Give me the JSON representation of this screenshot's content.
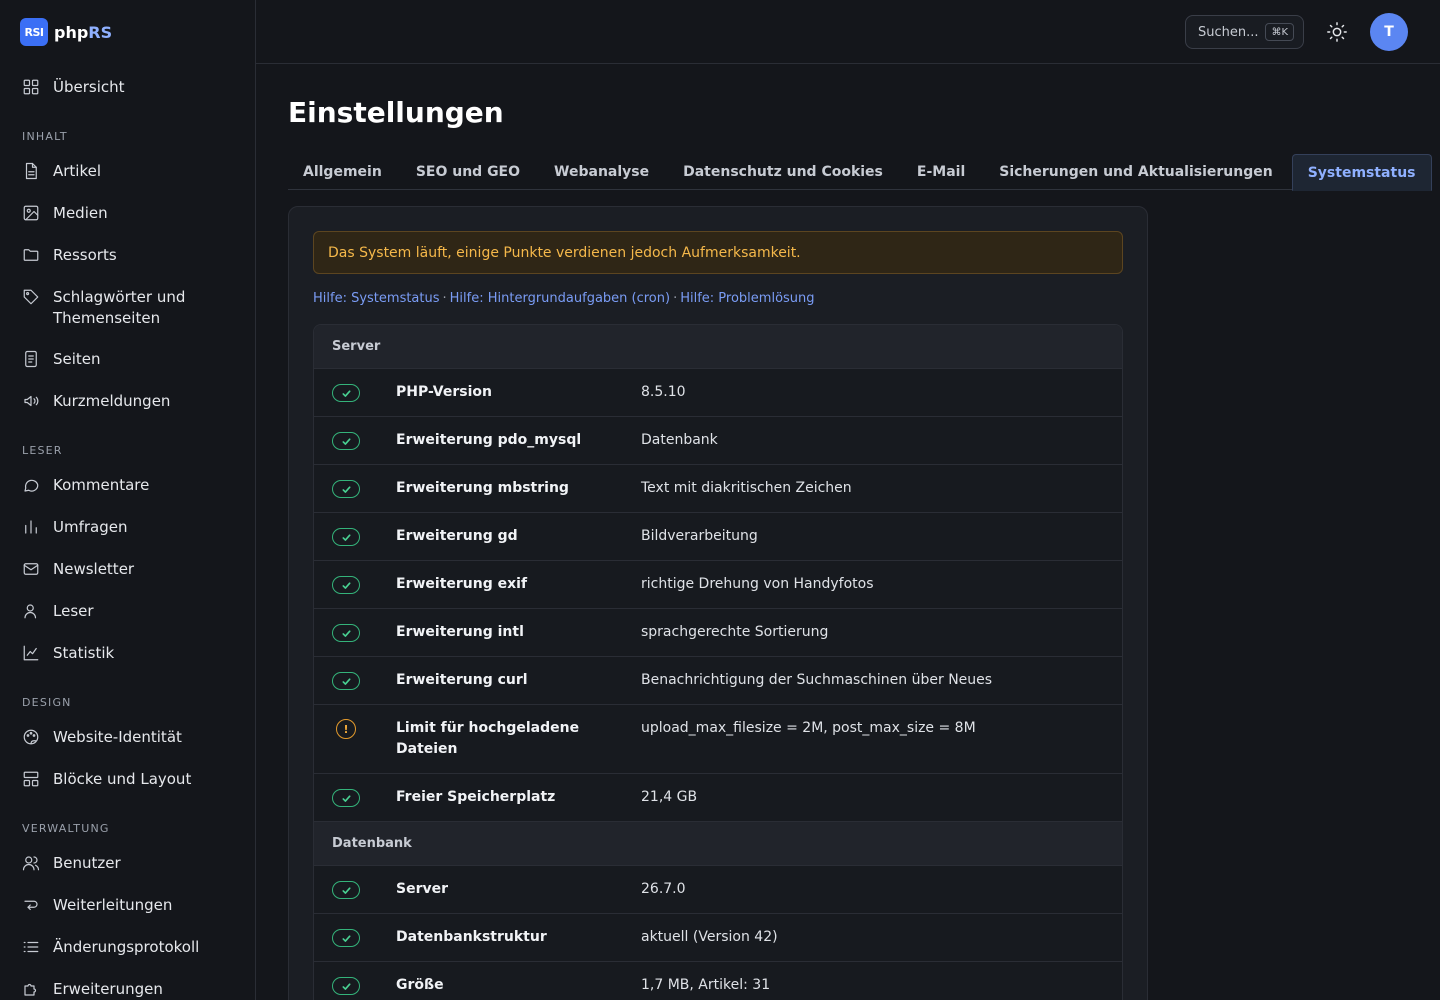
{
  "brand": {
    "badge": "RSI",
    "name_prefix": "php",
    "name_accent": "RS"
  },
  "sidebar": {
    "top_item": {
      "label": "Übersicht",
      "icon": "grid-icon"
    },
    "sections": [
      {
        "title": "INHALT",
        "items": [
          {
            "label": "Artikel",
            "icon": "document-icon"
          },
          {
            "label": "Medien",
            "icon": "image-icon"
          },
          {
            "label": "Ressorts",
            "icon": "folder-icon"
          },
          {
            "label": "Schlagwörter und Themenseiten",
            "icon": "tag-icon"
          },
          {
            "label": "Seiten",
            "icon": "page-icon"
          },
          {
            "label": "Kurzmeldungen",
            "icon": "speaker-icon"
          }
        ]
      },
      {
        "title": "LESER",
        "items": [
          {
            "label": "Kommentare",
            "icon": "comment-icon"
          },
          {
            "label": "Umfragen",
            "icon": "poll-icon"
          },
          {
            "label": "Newsletter",
            "icon": "mail-icon"
          },
          {
            "label": "Leser",
            "icon": "user-icon"
          },
          {
            "label": "Statistik",
            "icon": "chart-icon"
          }
        ]
      },
      {
        "title": "DESIGN",
        "items": [
          {
            "label": "Website-Identität",
            "icon": "palette-icon"
          },
          {
            "label": "Blöcke und Layout",
            "icon": "layout-icon"
          }
        ]
      },
      {
        "title": "VERWALTUNG",
        "items": [
          {
            "label": "Benutzer",
            "icon": "users-icon"
          },
          {
            "label": "Weiterleitungen",
            "icon": "redirect-icon"
          },
          {
            "label": "Änderungsprotokoll",
            "icon": "list-icon"
          },
          {
            "label": "Erweiterungen",
            "icon": "puzzle-icon"
          }
        ]
      }
    ]
  },
  "topbar": {
    "search_label": "Suchen...",
    "shortcut": "⌘K",
    "avatar_initial": "T"
  },
  "page": {
    "title": "Einstellungen",
    "tabs": [
      {
        "label": "Allgemein",
        "active": false
      },
      {
        "label": "SEO und GEO",
        "active": false
      },
      {
        "label": "Webanalyse",
        "active": false
      },
      {
        "label": "Datenschutz und Cookies",
        "active": false
      },
      {
        "label": "E-Mail",
        "active": false
      },
      {
        "label": "Sicherungen und Aktualisierungen",
        "active": false
      },
      {
        "label": "Systemstatus",
        "active": true
      }
    ],
    "alert": "Das System läuft, einige Punkte verdienen jedoch Aufmerksamkeit.",
    "help_links": [
      "Hilfe: Systemstatus",
      "Hilfe: Hintergrundaufgaben (cron)",
      "Hilfe: Problemlösung"
    ],
    "groups": [
      {
        "title": "Server",
        "rows": [
          {
            "status": "ok",
            "label": "PHP-Version",
            "value": "8.5.10"
          },
          {
            "status": "ok",
            "label": "Erweiterung pdo_mysql",
            "value": "Datenbank"
          },
          {
            "status": "ok",
            "label": "Erweiterung mbstring",
            "value": "Text mit diakritischen Zeichen"
          },
          {
            "status": "ok",
            "label": "Erweiterung gd",
            "value": "Bildverarbeitung"
          },
          {
            "status": "ok",
            "label": "Erweiterung exif",
            "value": "richtige Drehung von Handyfotos"
          },
          {
            "status": "ok",
            "label": "Erweiterung intl",
            "value": "sprachgerechte Sortierung"
          },
          {
            "status": "ok",
            "label": "Erweiterung curl",
            "value": "Benachrichtigung der Suchmaschinen über Neues"
          },
          {
            "status": "warn",
            "label": "Limit für hochgeladene Dateien",
            "value": "upload_max_filesize = 2M, post_max_size = 8M"
          },
          {
            "status": "ok",
            "label": "Freier Speicherplatz",
            "value": "21,4 GB"
          }
        ]
      },
      {
        "title": "Datenbank",
        "rows": [
          {
            "status": "ok",
            "label": "Server",
            "value": "26.7.0"
          },
          {
            "status": "ok",
            "label": "Datenbankstruktur",
            "value": "aktuell (Version 42)"
          },
          {
            "status": "ok",
            "label": "Größe",
            "value": "1,7 MB, Artikel: 31"
          }
        ]
      }
    ]
  },
  "colors": {
    "accent": "#8fb0ff",
    "ok": "#49d192",
    "warn": "#f0a93a",
    "background": "#14161b"
  }
}
